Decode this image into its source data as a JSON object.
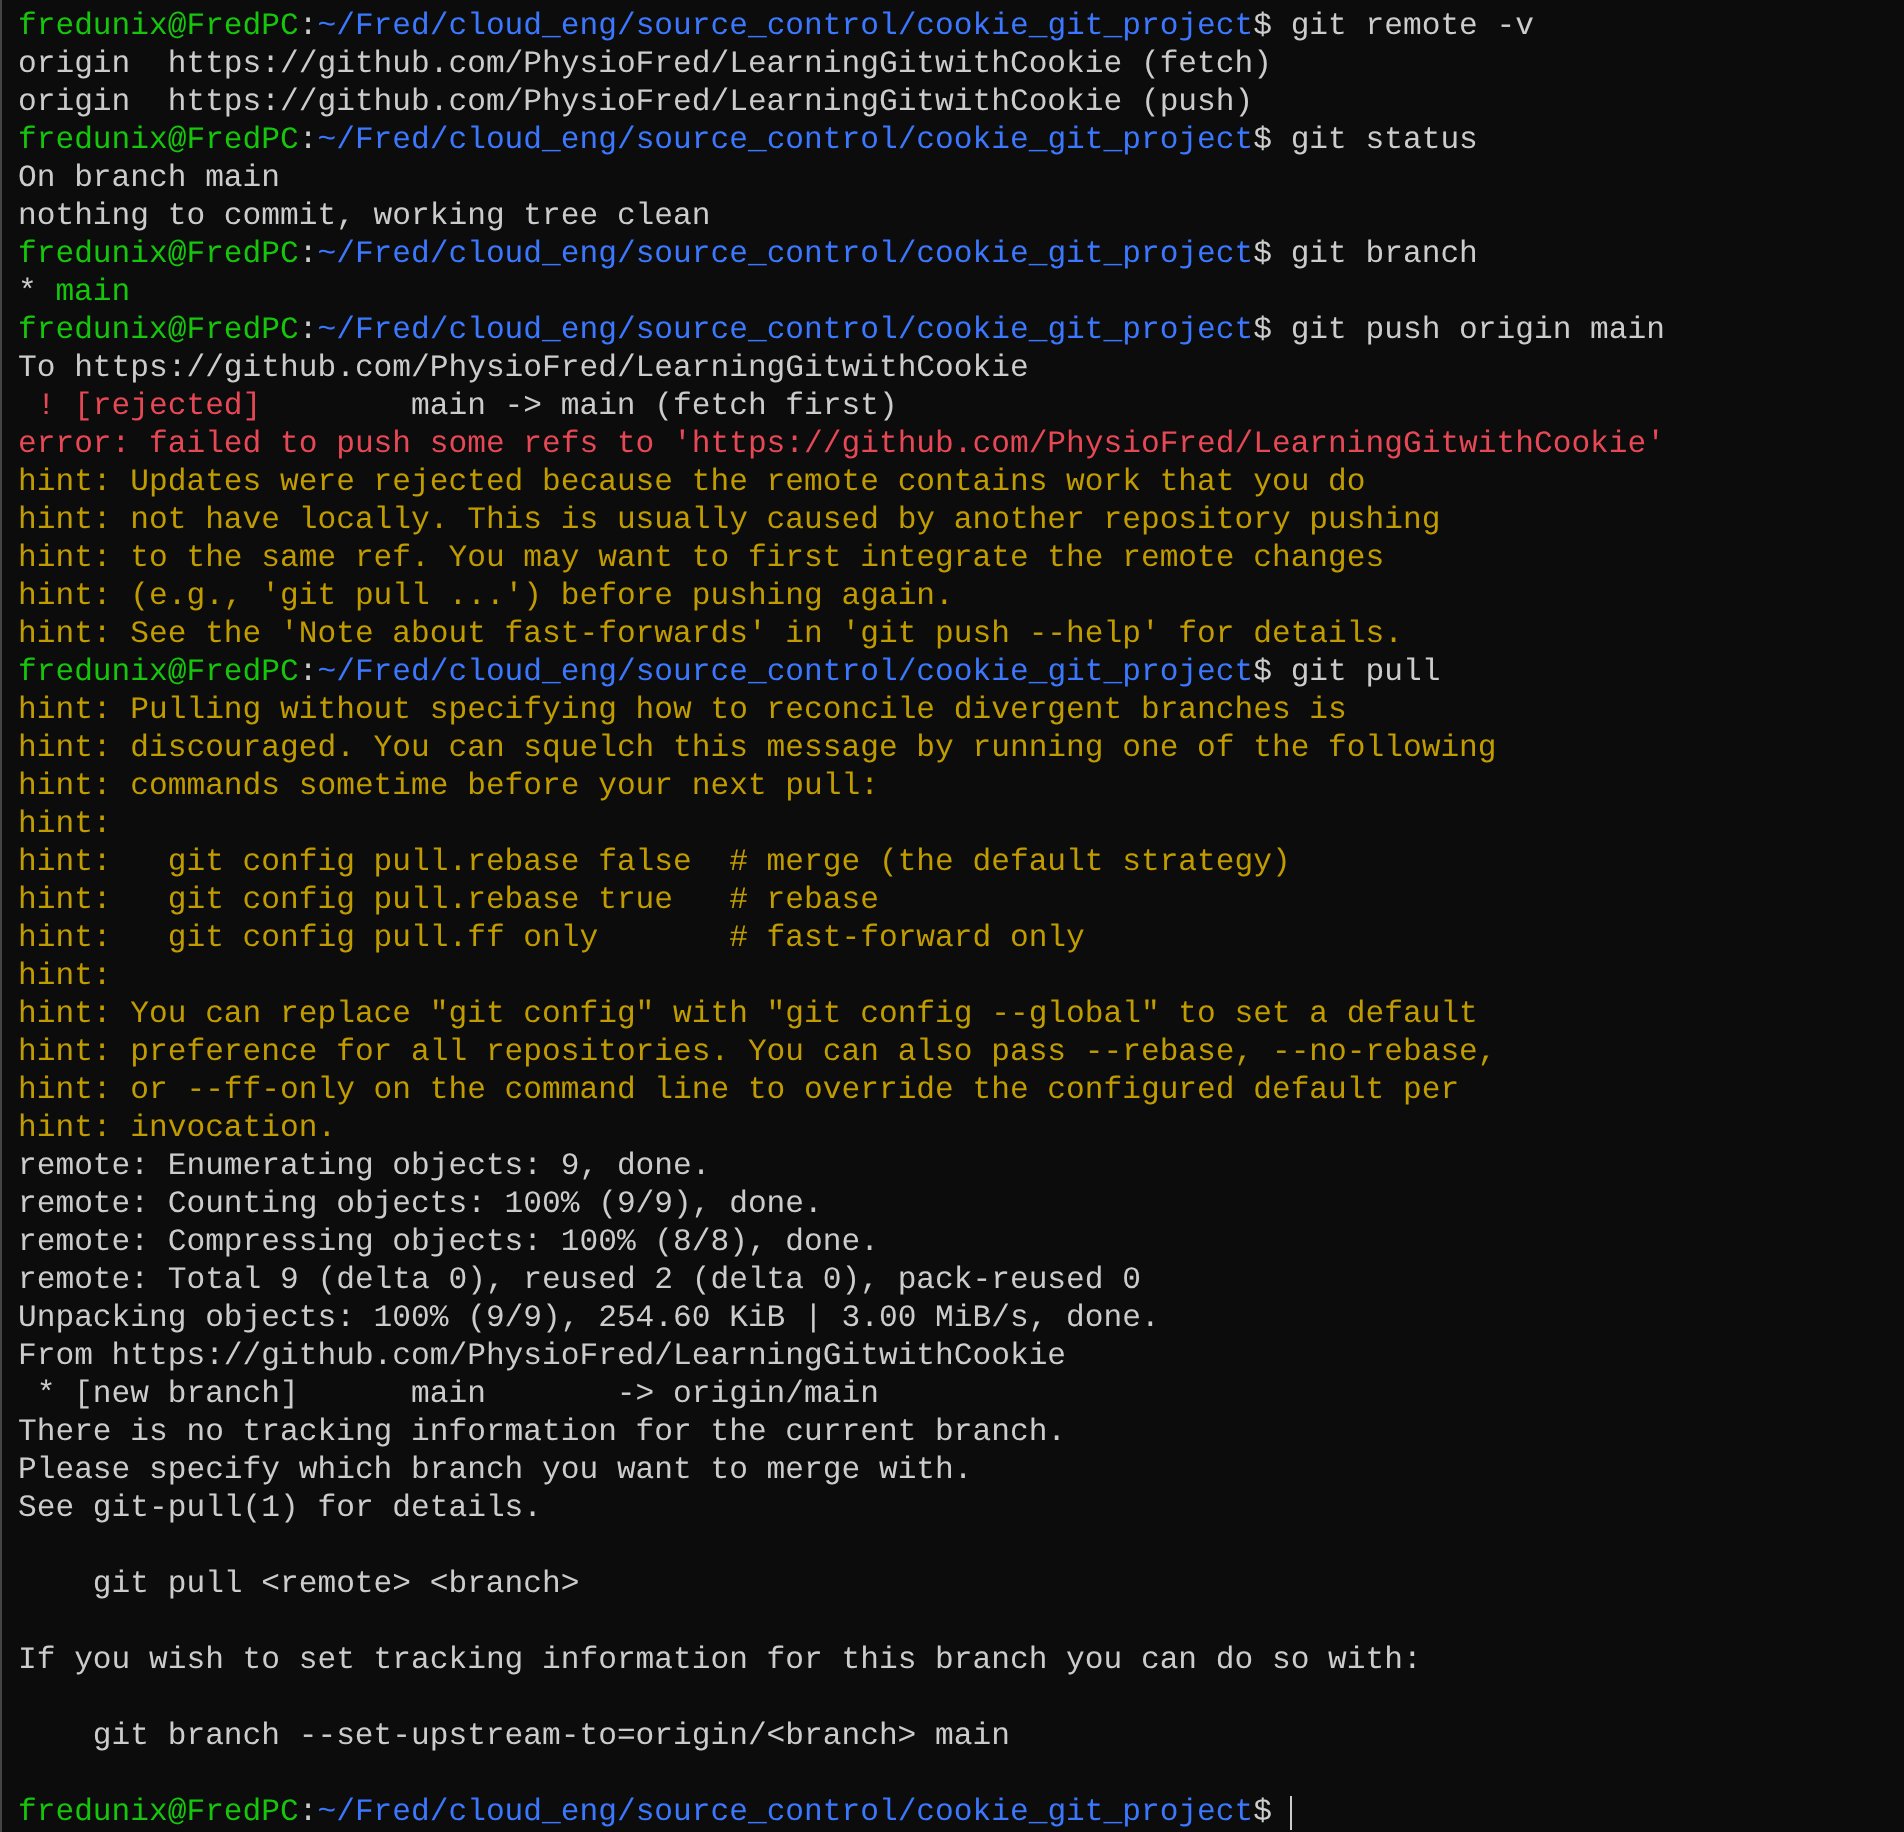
{
  "terminal": {
    "lines": [
      {
        "kind": "prompt",
        "user_host": "fredunix@FredPC",
        "separator": ":",
        "path": "~/Fred/cloud_eng/source_control/cookie_git_project",
        "symbol": "$",
        "command": "git remote -v"
      },
      {
        "kind": "output",
        "text": "origin  https://github.com/PhysioFred/LearningGitwithCookie (fetch)"
      },
      {
        "kind": "output",
        "text": "origin  https://github.com/PhysioFred/LearningGitwithCookie (push)"
      },
      {
        "kind": "prompt",
        "user_host": "fredunix@FredPC",
        "separator": ":",
        "path": "~/Fred/cloud_eng/source_control/cookie_git_project",
        "symbol": "$",
        "command": "git status"
      },
      {
        "kind": "output",
        "text": "On branch main"
      },
      {
        "kind": "output",
        "text": "nothing to commit, working tree clean"
      },
      {
        "kind": "prompt",
        "user_host": "fredunix@FredPC",
        "separator": ":",
        "path": "~/Fred/cloud_eng/source_control/cookie_git_project",
        "symbol": "$",
        "command": "git branch"
      },
      {
        "kind": "branch",
        "marker": "*",
        "name": "main"
      },
      {
        "kind": "prompt",
        "user_host": "fredunix@FredPC",
        "separator": ":",
        "path": "~/Fred/cloud_eng/source_control/cookie_git_project",
        "symbol": "$",
        "command": "git push origin main"
      },
      {
        "kind": "output",
        "text": "To https://github.com/PhysioFred/LearningGitwithCookie"
      },
      {
        "kind": "rejected",
        "flag": "! [rejected]",
        "detail": "main -> main (fetch first)"
      },
      {
        "kind": "error",
        "text": "error: failed to push some refs to 'https://github.com/PhysioFred/LearningGitwithCookie'"
      },
      {
        "kind": "hint",
        "text": "hint: Updates were rejected because the remote contains work that you do"
      },
      {
        "kind": "hint",
        "text": "hint: not have locally. This is usually caused by another repository pushing"
      },
      {
        "kind": "hint",
        "text": "hint: to the same ref. You may want to first integrate the remote changes"
      },
      {
        "kind": "hint",
        "text": "hint: (e.g., 'git pull ...') before pushing again."
      },
      {
        "kind": "hint",
        "text": "hint: See the 'Note about fast-forwards' in 'git push --help' for details."
      },
      {
        "kind": "prompt",
        "user_host": "fredunix@FredPC",
        "separator": ":",
        "path": "~/Fred/cloud_eng/source_control/cookie_git_project",
        "symbol": "$",
        "command": "git pull"
      },
      {
        "kind": "hint",
        "text": "hint: Pulling without specifying how to reconcile divergent branches is"
      },
      {
        "kind": "hint",
        "text": "hint: discouraged. You can squelch this message by running one of the following"
      },
      {
        "kind": "hint",
        "text": "hint: commands sometime before your next pull:"
      },
      {
        "kind": "hint",
        "text": "hint:"
      },
      {
        "kind": "hint",
        "text": "hint:   git config pull.rebase false  # merge (the default strategy)"
      },
      {
        "kind": "hint",
        "text": "hint:   git config pull.rebase true   # rebase"
      },
      {
        "kind": "hint",
        "text": "hint:   git config pull.ff only       # fast-forward only"
      },
      {
        "kind": "hint",
        "text": "hint:"
      },
      {
        "kind": "hint",
        "text": "hint: You can replace \"git config\" with \"git config --global\" to set a default"
      },
      {
        "kind": "hint",
        "text": "hint: preference for all repositories. You can also pass --rebase, --no-rebase,"
      },
      {
        "kind": "hint",
        "text": "hint: or --ff-only on the command line to override the configured default per"
      },
      {
        "kind": "hint",
        "text": "hint: invocation."
      },
      {
        "kind": "output",
        "text": "remote: Enumerating objects: 9, done."
      },
      {
        "kind": "output",
        "text": "remote: Counting objects: 100% (9/9), done."
      },
      {
        "kind": "output",
        "text": "remote: Compressing objects: 100% (8/8), done."
      },
      {
        "kind": "output",
        "text": "remote: Total 9 (delta 0), reused 2 (delta 0), pack-reused 0"
      },
      {
        "kind": "output",
        "text": "Unpacking objects: 100% (9/9), 254.60 KiB | 3.00 MiB/s, done."
      },
      {
        "kind": "output",
        "text": "From https://github.com/PhysioFred/LearningGitwithCookie"
      },
      {
        "kind": "ref",
        "text": "* [new branch]      main       -> origin/main"
      },
      {
        "kind": "output",
        "text": "There is no tracking information for the current branch."
      },
      {
        "kind": "output",
        "text": "Please specify which branch you want to merge with."
      },
      {
        "kind": "output",
        "text": "See git-pull(1) for details."
      },
      {
        "kind": "blank"
      },
      {
        "kind": "indented",
        "text": "git pull <remote> <branch>"
      },
      {
        "kind": "blank"
      },
      {
        "kind": "output",
        "text": "If you wish to set tracking information for this branch you can do so with:"
      },
      {
        "kind": "blank"
      },
      {
        "kind": "indented",
        "text": "git branch --set-upstream-to=origin/<branch> main"
      },
      {
        "kind": "blank"
      },
      {
        "kind": "prompt",
        "user_host": "fredunix@FredPC",
        "separator": ":",
        "path": "~/Fred/cloud_eng/source_control/cookie_git_project",
        "symbol": "$",
        "cursor": true
      }
    ]
  }
}
